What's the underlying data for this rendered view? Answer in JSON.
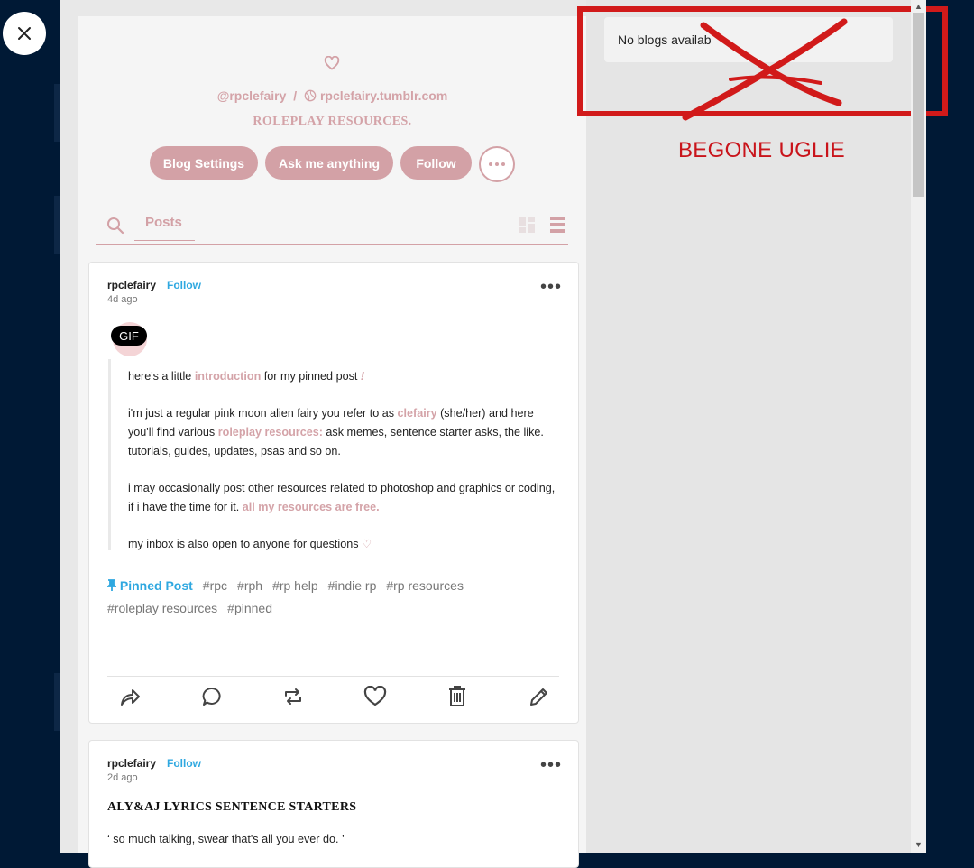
{
  "window": {
    "close_icon": "close-icon"
  },
  "sidebar_panel": {
    "empty_message": "No blogs availab",
    "annotation": "BEGONE UGLIE",
    "annotation_color": "#c9141b"
  },
  "blog": {
    "handle": "@rpclefairy",
    "separator": "/",
    "url": "rpclefairy.tumblr.com",
    "description": "ROLEPLAY RESOURCES.",
    "accent_color": "#d3a1a6",
    "buttons": {
      "settings": "Blog Settings",
      "ask": "Ask me anything",
      "follow": "Follow"
    },
    "tabs": {
      "posts": "Posts"
    }
  },
  "posts": [
    {
      "username": "rpclefairy",
      "follow_label": "Follow",
      "time": "4d ago",
      "gif_label": "GIF",
      "body": {
        "p1_a": "here's a little ",
        "p1_link": "introduction",
        "p1_b": " for my pinned post ",
        "p1_c": "!",
        "p2_a": "i'm just a regular pink moon alien fairy you refer to as ",
        "p2_link": "clefairy",
        "p2_b": " (she/her) and here you'll find various ",
        "p2_link2": "roleplay resources:",
        "p2_c": " ask memes, sentence starter asks, the like. tutorials, guides, updates, psas and so on.",
        "p3_a": "i may occasionally post other resources related to photoshop and graphics or coding, if i have the time for it. ",
        "p3_link": "all my resources are free.",
        "p4_a": "my inbox is also open to anyone for questions ",
        "p4_heart": "♡"
      },
      "pinned_label": "Pinned Post",
      "tags": [
        "#rpc",
        "#rph",
        "#rp help",
        "#indie rp",
        "#rp resources",
        "#roleplay resources",
        "#pinned"
      ]
    },
    {
      "username": "rpclefairy",
      "follow_label": "Follow",
      "time": "2d ago",
      "title": "ALY&AJ LYRICS SENTENCE STARTERS",
      "first_line": "‘ so much talking, swear that's all you ever do. ’"
    }
  ]
}
